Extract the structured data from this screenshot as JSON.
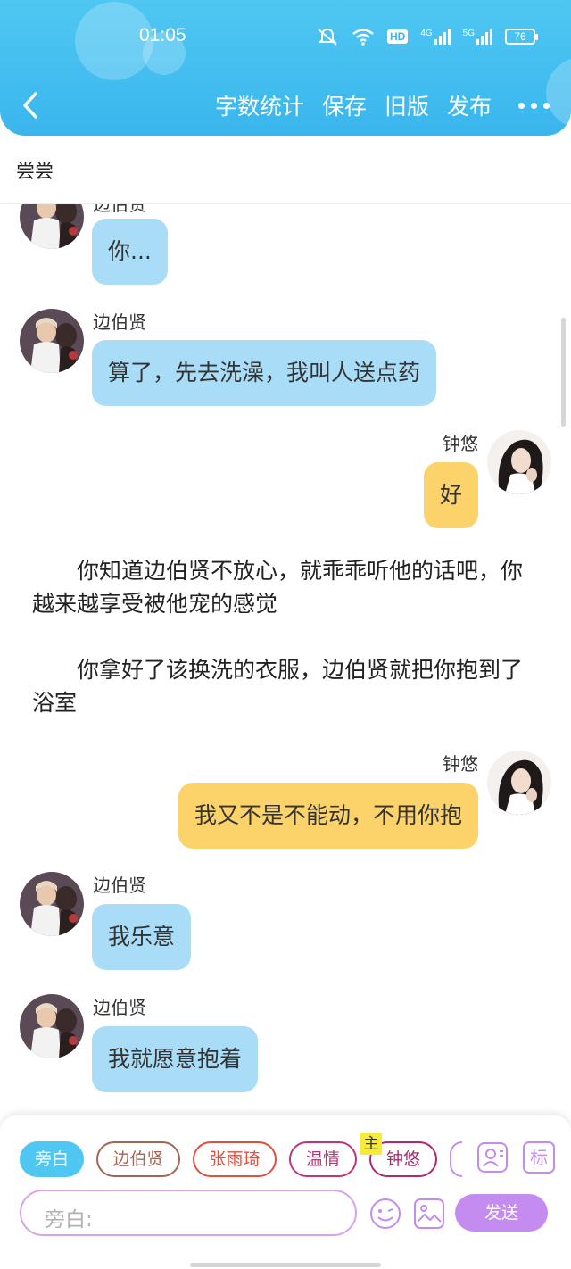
{
  "status_bar": {
    "time": "01:05",
    "hd": "HD",
    "net_4g": "4G",
    "net_5g": "5G",
    "battery": "76"
  },
  "header": {
    "toolbar": [
      {
        "label": "字数统计"
      },
      {
        "label": "保存"
      },
      {
        "label": "旧版"
      },
      {
        "label": "发布"
      }
    ],
    "more": "more-icon"
  },
  "document": {
    "title": "尝尝"
  },
  "chat": {
    "messages": [
      {
        "type": "message",
        "side": "left",
        "name": "边伯贤",
        "text": "你..."
      },
      {
        "type": "message",
        "side": "left",
        "name": "边伯贤",
        "text": "算了，先去洗澡，我叫人送点药"
      },
      {
        "type": "message",
        "side": "right",
        "name": "钟悠",
        "text": "好"
      },
      {
        "type": "narration",
        "text": "你知道边伯贤不放心，就乖乖听他的话吧，你越来越享受被他宠的感觉"
      },
      {
        "type": "narration",
        "text": "你拿好了该换洗的衣服，边伯贤就把你抱到了浴室"
      },
      {
        "type": "message",
        "side": "right",
        "name": "钟悠",
        "text": "我又不是不能动，不用你抱"
      },
      {
        "type": "message",
        "side": "left",
        "name": "边伯贤",
        "text": "我乐意"
      },
      {
        "type": "message",
        "side": "left",
        "name": "边伯贤",
        "text": "我就愿意抱着"
      }
    ]
  },
  "composer": {
    "roles": [
      {
        "label": "旁白",
        "color": "#4fc7f2",
        "selected": true
      },
      {
        "label": "边伯贤",
        "color": "#a36655"
      },
      {
        "label": "张雨琦",
        "color": "#e0503e"
      },
      {
        "label": "温情",
        "color": "#c0357a"
      },
      {
        "label": "钟悠",
        "color": "#b0286e"
      }
    ],
    "main_badge": "主",
    "tag_button": "标",
    "input_placeholder": "旁白:",
    "send_label": "发送"
  },
  "colors": {
    "header": "#3ab6ee",
    "left_bubble": "#a8dcf7",
    "right_bubble": "#fcd36a",
    "accent": "#c48cf0"
  }
}
